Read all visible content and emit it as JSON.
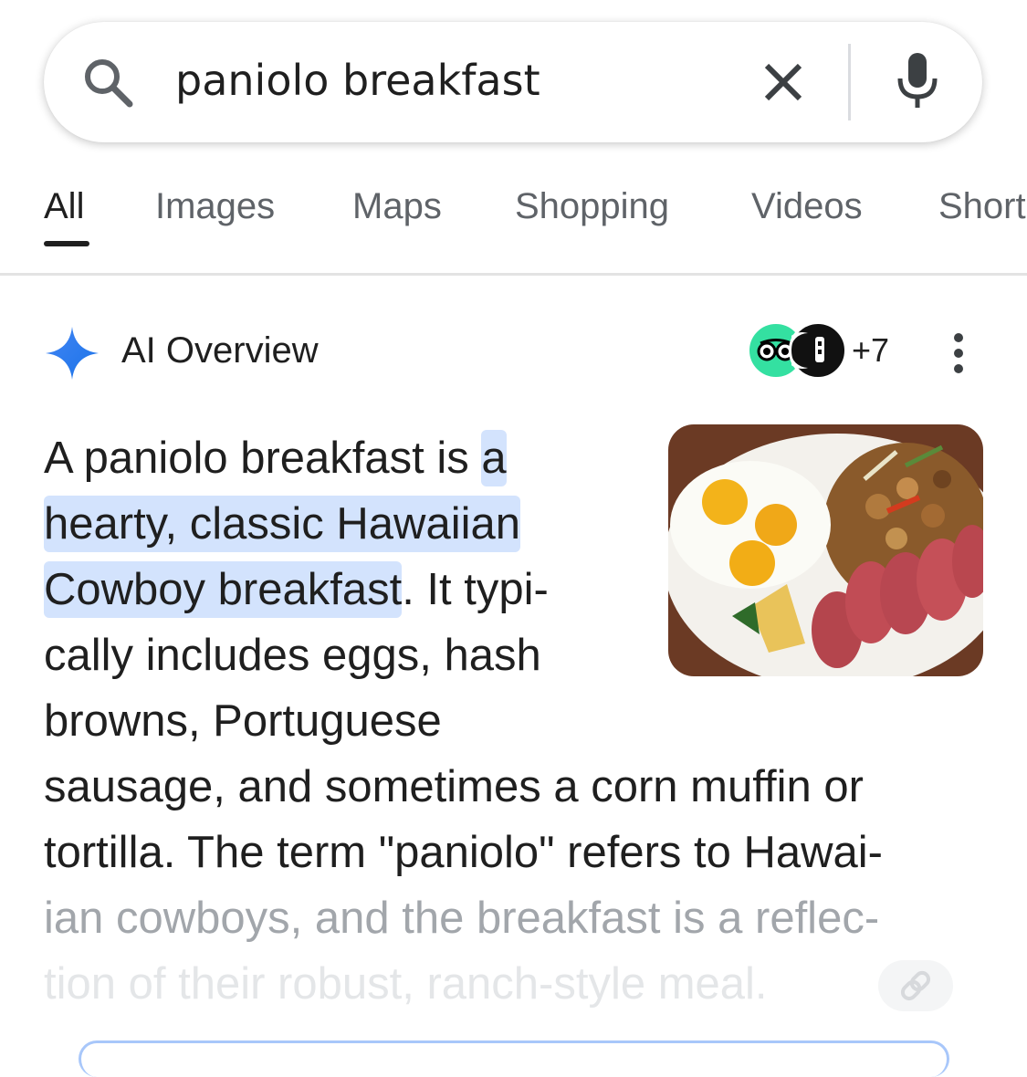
{
  "search": {
    "query": "paniolo breakfast"
  },
  "tabs": [
    {
      "label": "All"
    },
    {
      "label": "Images"
    },
    {
      "label": "Maps"
    },
    {
      "label": "Shopping"
    },
    {
      "label": "Videos"
    },
    {
      "label": "Short"
    }
  ],
  "ai_overview": {
    "title": "AI Overview",
    "sources_more": "+7",
    "text_lines": [
      {
        "plain": "A paniolo breakfast is ",
        "highlight": "a"
      },
      {
        "highlight": "hearty, classic Hawaiian"
      },
      {
        "highlight": "Cowboy breakfast",
        "plain": ". It typi-"
      },
      {
        "plain": "cally includes eggs, hash"
      },
      {
        "plain": "browns, Portuguese"
      },
      {
        "plain": "sausage, and sometimes a corn muffin or"
      },
      {
        "plain": "tortilla. The term \"paniolo\" refers to Hawai-"
      },
      {
        "plain": "ian cowboys, and the breakfast is a reflec-"
      },
      {
        "plain": "tion of their robust, ranch-style meal."
      }
    ]
  },
  "colors": {
    "highlight": "#d3e3fd",
    "accent_blue": "#4285f4",
    "tripadvisor_green": "#34e0a1"
  },
  "icons": [
    "search-icon",
    "clear-icon",
    "mic-icon",
    "sparkle-icon",
    "more-vert-icon",
    "link-icon"
  ]
}
